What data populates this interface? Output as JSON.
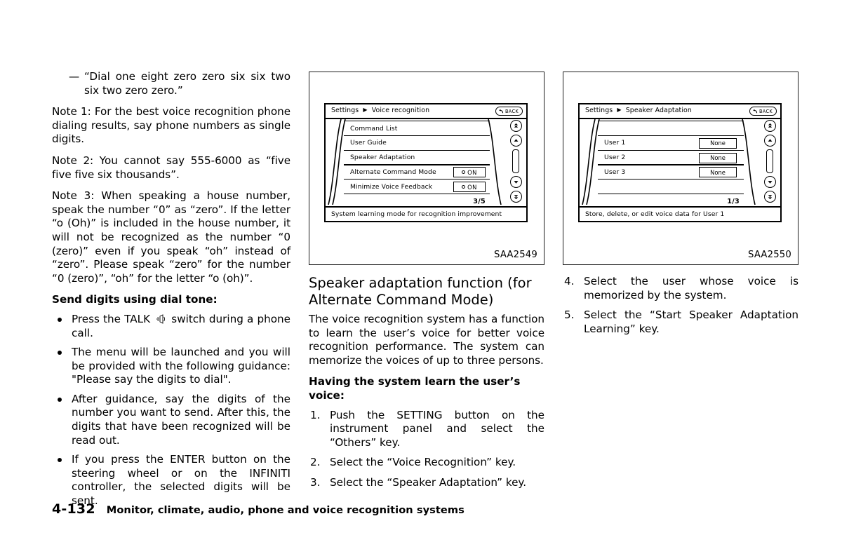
{
  "document": {
    "folio": "4-132",
    "footer_title": "Monitor, climate, audio, phone and voice recognition systems"
  },
  "left_column": {
    "dash_item": "“Dial one eight zero zero six six two six two zero zero.”",
    "note1": "Note 1: For the best voice recognition phone dialing results, say phone numbers as single digits.",
    "note2": "Note 2: You cannot say 555-6000 as “five five five six thousands”.",
    "note3": "Note 3: When speaking a house number, speak the number “0” as “zero”. If the letter “o (Oh)” is included in the house number, it will not be recognized as the number “0 (zero)” even if you speak “oh” instead of “zero”. Please speak “zero” for the number “0 (zero)”, “oh” for the letter “o (oh)”.",
    "send_digits_heading": "Send digits using dial tone:",
    "bullets": [
      {
        "text_before_icon": "Press the TALK",
        "icon": "talk-switch-icon",
        "text_after_icon": "switch during a phone call."
      },
      {
        "text": "The menu will be launched and you will be provided with the following guidance: \"Please say the digits to dial\"."
      },
      {
        "text": "After guidance, say the digits of the number you want to send. After this, the digits that have been recognized will be read out."
      },
      {
        "text": "If you press the ENTER button on the steering wheel or on the INFINITI controller, the selected digits will be sent."
      }
    ]
  },
  "figure_1": {
    "caption": "SAA2549",
    "screen": {
      "breadcrumb_root": "Settings",
      "breadcrumb_leaf": "Voice recognition",
      "back_label": "BACK",
      "rows": [
        {
          "label": "Command List",
          "control": "none"
        },
        {
          "label": "User Guide",
          "control": "none"
        },
        {
          "label": "Speaker Adaptation",
          "control": "none"
        },
        {
          "label": "Alternate Command Mode",
          "control": "toggle",
          "value": "ON"
        },
        {
          "label": "Minimize Voice Feedback",
          "control": "toggle",
          "value": "ON"
        }
      ],
      "page_count": "3/5",
      "status_text": "System learning mode for recognition improvement"
    }
  },
  "figure_2": {
    "caption": "SAA2550",
    "screen": {
      "breadcrumb_root": "Settings",
      "breadcrumb_leaf": "Speaker Adaptation",
      "back_label": "BACK",
      "rows": [
        {
          "label": "",
          "control": "none"
        },
        {
          "label": "User 1",
          "control": "value",
          "value": "None"
        },
        {
          "label": "User 2",
          "control": "value",
          "value": "None"
        },
        {
          "label": "User 3",
          "control": "value",
          "value": "None"
        },
        {
          "label": "",
          "control": "none"
        }
      ],
      "page_count": "1/3",
      "status_text": "Store, delete, or edit voice data for User 1"
    }
  },
  "middle_column": {
    "section_heading": "Speaker adaptation function (for Alternate Command Mode)",
    "intro": "The voice recognition system has a function to learn the user’s voice for better voice recognition performance. The system can memorize the voices of up to three persons.",
    "sub_heading": "Having the system learn the user’s voice:",
    "steps": [
      {
        "num": "1.",
        "text": "Push the SETTING button on the instrument panel and select the “Others” key."
      },
      {
        "num": "2.",
        "text": "Select the “Voice Recognition” key."
      },
      {
        "num": "3.",
        "text": "Select the “Speaker Adaptation” key."
      }
    ]
  },
  "right_column": {
    "steps": [
      {
        "num": "4.",
        "text": "Select the user whose voice is memorized by the system."
      },
      {
        "num": "5.",
        "text": "Select the “Start Speaker Adaptation Learning” key."
      }
    ]
  }
}
